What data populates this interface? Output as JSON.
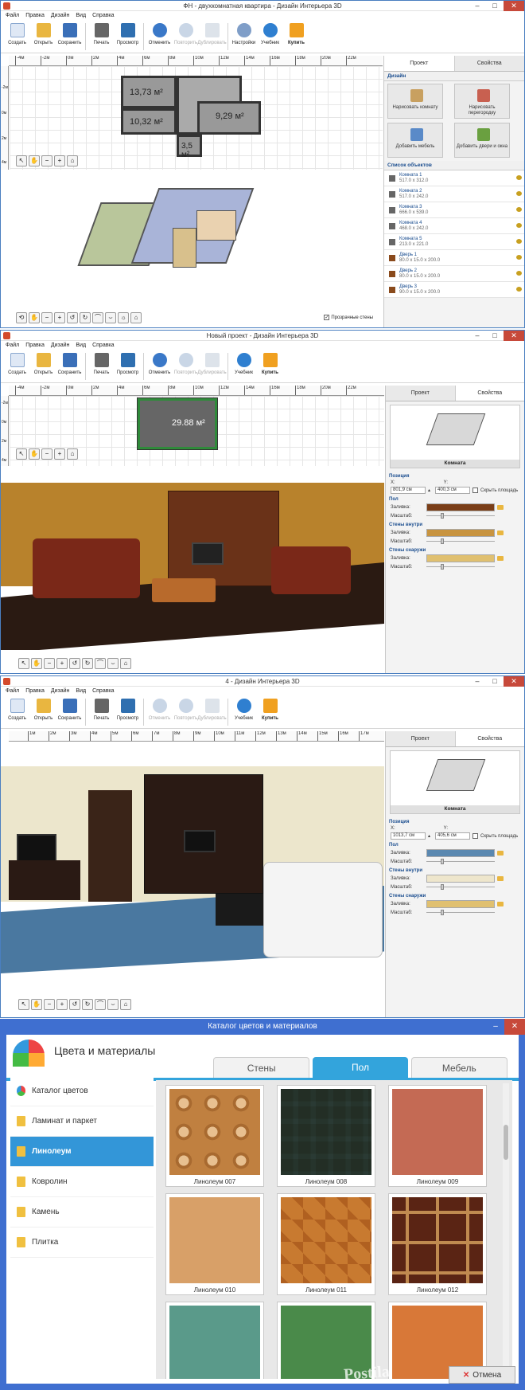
{
  "w1": {
    "title": "ФН - двухкомнатная квартира - Дизайн Интерьера 3D",
    "menu": [
      "Файл",
      "Правка",
      "Дизайн",
      "Вид",
      "Справка"
    ],
    "toolbar": [
      "Создать",
      "Открыть",
      "Сохранить",
      "Печать",
      "Просмотр",
      "Отменить",
      "Повторить",
      "Дублировать",
      "Настройки",
      "Учебник",
      "Купить"
    ],
    "ruler": [
      "-4м",
      "-2м",
      "0м",
      "2м",
      "4м",
      "6м",
      "8м",
      "10м",
      "12м",
      "14м",
      "16м",
      "18м",
      "20м",
      "22м"
    ],
    "vruler": [
      "-2м",
      "0м",
      "2м",
      "4м"
    ],
    "plan": {
      "r1": "13,73 м²",
      "r2": "10,32 м²",
      "r3": "9,29 м²",
      "r4": "3,5 м²"
    },
    "tabs": [
      "Проект",
      "Свойства"
    ],
    "design_head": "Дизайн",
    "design_buttons": [
      "Нарисовать комнату",
      "Нарисовать перегородку",
      "Добавить мебель",
      "Добавить двери и окна"
    ],
    "objects_head": "Список объектов",
    "objects": [
      {
        "n": "Комната 1",
        "s": "517.0 x 312.0"
      },
      {
        "n": "Комната 2",
        "s": "517.0 x 242.0"
      },
      {
        "n": "Комната 3",
        "s": "666.0 x 539.0"
      },
      {
        "n": "Комната 4",
        "s": "468.0 x 242.0"
      },
      {
        "n": "Комната 5",
        "s": "213.0 x 221.0"
      },
      {
        "n": "Дверь 1",
        "s": "80.0 x 15.0 x 200.0"
      },
      {
        "n": "Дверь 2",
        "s": "80.0 x 15.0 x 200.0"
      },
      {
        "n": "Дверь 3",
        "s": "90.0 x 15.0 x 200.0"
      }
    ],
    "transparent": "Прозрачные стены"
  },
  "w2": {
    "title": "Новый проект - Дизайн Интерьера 3D",
    "menu": [
      "Файл",
      "Правка",
      "Дизайн",
      "Вид",
      "Справка"
    ],
    "toolbar": [
      "Создать",
      "Открыть",
      "Сохранить",
      "Печать",
      "Просмотр",
      "Отменить",
      "Повторить",
      "Дублировать",
      "Учебник",
      "Купить"
    ],
    "ruler": [
      "-4м",
      "-2м",
      "0м",
      "2м",
      "4м",
      "6м",
      "8м",
      "10м",
      "12м",
      "14м",
      "16м",
      "18м",
      "20м",
      "22м"
    ],
    "vruler": [
      "-2м",
      "0м",
      "2м",
      "4м"
    ],
    "area": "29.88 м²",
    "tabs": [
      "Проект",
      "Свойства"
    ],
    "obj": "Комната",
    "pos": "Позиция",
    "x_label": "X:",
    "x_val": "801,9 см",
    "y_label": "Y:",
    "y_val": "400,3 см",
    "hide_area": "Скрыть площадь",
    "floor": "Пол",
    "walls_in": "Стены внутри",
    "walls_out": "Стены снаружи",
    "fill": "Заливка:",
    "scale": "Масштаб:"
  },
  "w3": {
    "title": "4 - Дизайн Интерьера 3D",
    "menu": [
      "Файл",
      "Правка",
      "Дизайн",
      "Вид",
      "Справка"
    ],
    "toolbar": [
      "Создать",
      "Открыть",
      "Сохранить",
      "Печать",
      "Просмотр",
      "Отменить",
      "Повторить",
      "Дублировать",
      "Учебник",
      "Купить"
    ],
    "ruler": [
      "1м",
      "2м",
      "3м",
      "4м",
      "5м",
      "6м",
      "7м",
      "8м",
      "9м",
      "10м",
      "11м",
      "12м",
      "13м",
      "14м",
      "15м",
      "16м",
      "17м"
    ],
    "tabs": [
      "Проект",
      "Свойства"
    ],
    "obj": "Комната",
    "pos": "Позиция",
    "x_label": "X:",
    "x_val": "1013,7 см",
    "y_label": "Y:",
    "y_val": "405,6 см",
    "hide_area": "Скрыть площадь",
    "floor": "Пол",
    "walls_in": "Стены внутри",
    "walls_out": "Стены снаружи",
    "fill": "Заливка:",
    "scale": "Масштаб:"
  },
  "w4": {
    "title": "Каталог цветов и материалов",
    "header": "Цвета и материалы",
    "tabs": [
      "Стены",
      "Пол",
      "Мебель"
    ],
    "side": [
      "Каталог цветов",
      "Ламинат и паркет",
      "Линолеум",
      "Ковролин",
      "Камень",
      "Плитка"
    ],
    "tiles": [
      "Линолеум 007",
      "Линолеум 008",
      "Линолеум 009",
      "Линолеум 010",
      "Линолеум 011",
      "Линолеум 012"
    ],
    "cancel": "Отмена",
    "watermark": "Postila"
  }
}
